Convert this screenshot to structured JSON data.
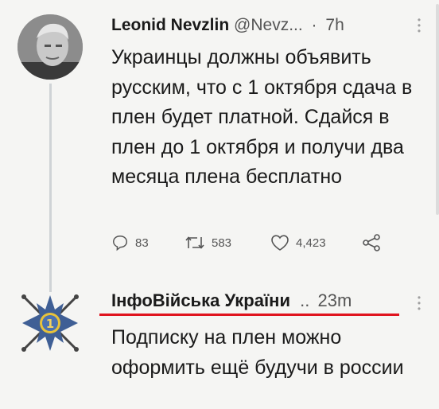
{
  "tweet_1": {
    "name": "Leonid Nevzlin",
    "handle": "@Nevz...",
    "separator": "·",
    "time": "7h",
    "text": "Украинцы должны объявить русским, что с 1 октября сдача в плен будет платной. Сдайся в плен до 1 октября и получи два месяца плена бесплатно",
    "actions": {
      "reply_count": "83",
      "retweet_count": "583",
      "like_count": "4,423"
    }
  },
  "tweet_2": {
    "name": "ІнфоВійська України",
    "separator": "..",
    "time": "23m",
    "text": "Подписку на плен можно оформить ещё будучи в россии",
    "underline_color": "#e0141e"
  },
  "icons": {
    "reply": "reply-icon",
    "retweet": "retweet-icon",
    "like": "like-icon",
    "share": "share-icon",
    "more": "more-vertical-icon",
    "emblem": "army-emblem-icon"
  }
}
